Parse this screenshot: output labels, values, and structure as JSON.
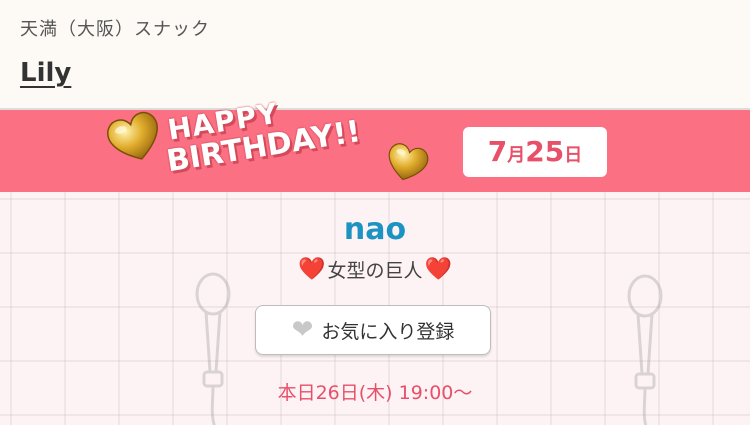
{
  "header": {
    "area": "天満（大阪）スナック",
    "shop_name": "Lily"
  },
  "banner": {
    "line1": "HAPPY",
    "line2": "BIRTHDAY!!",
    "date_month": "7",
    "date_month_unit": "月",
    "date_day": "25",
    "date_day_unit": "日",
    "background_color": "#fb7183"
  },
  "profile": {
    "name": "nao",
    "catchphrase": "女型の巨人",
    "heart_glyph": "❤️",
    "favorite_heart_glyph": "❤",
    "favorite_label": "お気に入り登録",
    "schedule": "本日26日(木) 19:00〜"
  },
  "colors": {
    "name": "#1c93c2",
    "accent": "#e8506a"
  },
  "icons": {
    "banner_hearts": "gold-heart-icon",
    "favorite": "heart-icon",
    "background": "shower-icon"
  }
}
